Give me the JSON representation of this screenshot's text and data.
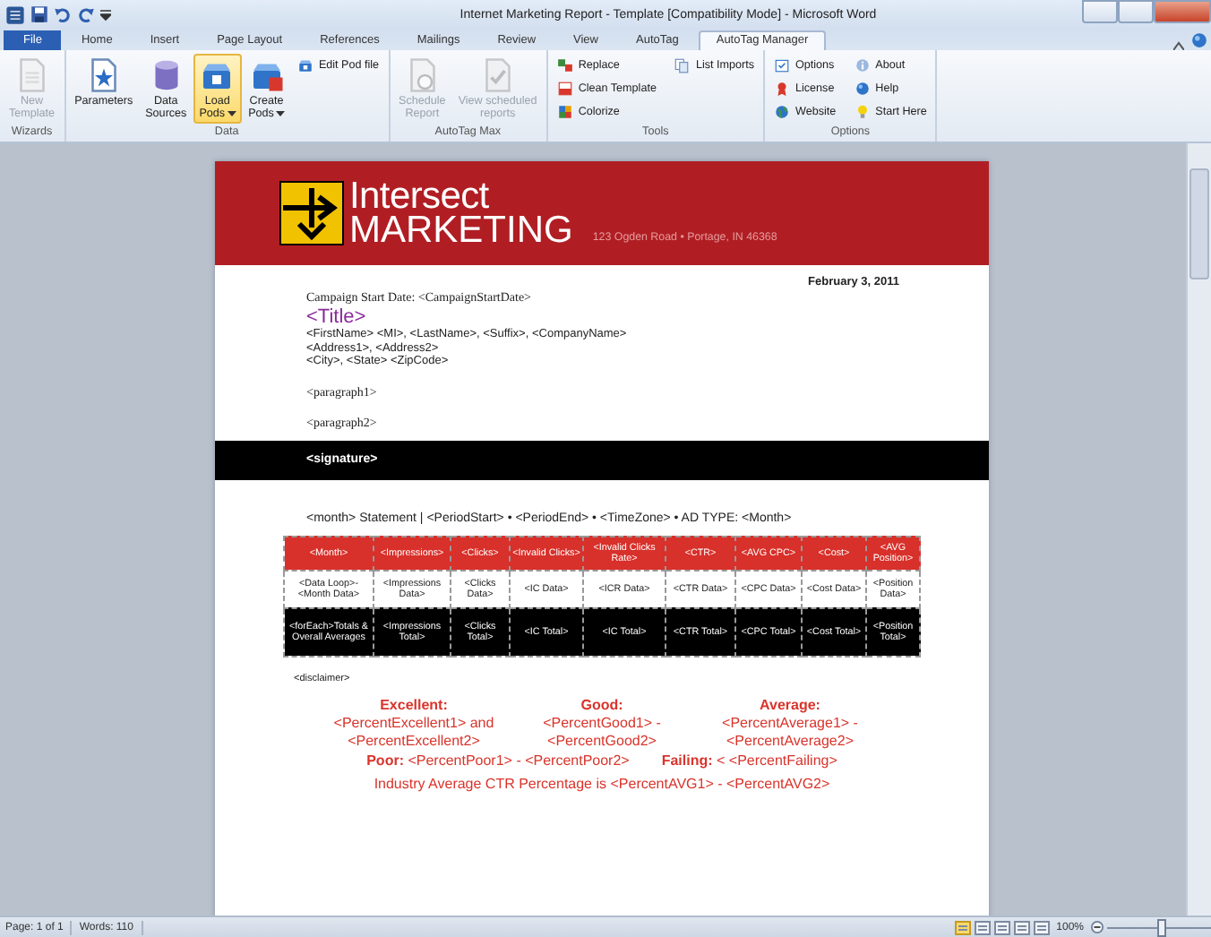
{
  "window": {
    "title": "Internet Marketing Report - Template [Compatibility Mode] - Microsoft Word"
  },
  "tabs": [
    {
      "label": "File",
      "kind": "file",
      "selected": false
    },
    {
      "label": "Home",
      "kind": "normal",
      "selected": false
    },
    {
      "label": "Insert",
      "kind": "normal",
      "selected": false
    },
    {
      "label": "Page Layout",
      "kind": "normal",
      "selected": false
    },
    {
      "label": "References",
      "kind": "normal",
      "selected": false
    },
    {
      "label": "Mailings",
      "kind": "normal",
      "selected": false
    },
    {
      "label": "Review",
      "kind": "normal",
      "selected": false
    },
    {
      "label": "View",
      "kind": "normal",
      "selected": false
    },
    {
      "label": "AutoTag",
      "kind": "normal",
      "selected": false
    },
    {
      "label": "AutoTag Manager",
      "kind": "normal",
      "selected": true
    }
  ],
  "ribbon": {
    "groups": [
      {
        "label": "Wizards",
        "large_buttons": [
          {
            "label_lines": [
              "New",
              "Template"
            ],
            "kind": "doc",
            "disabled": true,
            "highlighted": false,
            "dropdown": false
          }
        ]
      },
      {
        "label": "Data",
        "large_buttons": [
          {
            "label_lines": [
              "Parameters"
            ],
            "kind": "params",
            "disabled": false,
            "highlighted": false,
            "dropdown": false
          },
          {
            "label_lines": [
              "Data",
              "Sources"
            ],
            "kind": "db",
            "disabled": false,
            "highlighted": false,
            "dropdown": false
          },
          {
            "label_lines": [
              "Load",
              "Pods"
            ],
            "kind": "pods",
            "disabled": false,
            "highlighted": true,
            "dropdown": true
          },
          {
            "label_lines": [
              "Create",
              "Pods"
            ],
            "kind": "podscreate",
            "disabled": false,
            "highlighted": false,
            "dropdown": true
          }
        ],
        "small_buttons": [
          {
            "label": "Edit Pod file",
            "kind": "pods",
            "disabled": false
          }
        ]
      },
      {
        "label": "AutoTag Max",
        "large_buttons": [
          {
            "label_lines": [
              "Schedule",
              "Report"
            ],
            "kind": "schedule",
            "disabled": true,
            "highlighted": false,
            "dropdown": false
          },
          {
            "label_lines": [
              "View scheduled",
              "reports"
            ],
            "kind": "reports",
            "disabled": true,
            "highlighted": false,
            "dropdown": false
          }
        ]
      },
      {
        "label": "Tools",
        "small_buttons": [
          {
            "label": "Replace",
            "kind": "replace",
            "disabled": false
          },
          {
            "label": "Clean Template",
            "kind": "clean",
            "disabled": false
          },
          {
            "label": "Colorize",
            "kind": "colorize",
            "disabled": false
          },
          {
            "label": "List Imports",
            "kind": "list",
            "disabled": false
          }
        ]
      },
      {
        "label": "Options",
        "small_buttons": [
          {
            "label": "Options",
            "kind": "options",
            "disabled": false
          },
          {
            "label": "License",
            "kind": "license",
            "disabled": false
          },
          {
            "label": "Website",
            "kind": "website",
            "disabled": false
          },
          {
            "label": "About",
            "kind": "about",
            "disabled": false
          },
          {
            "label": "Help",
            "kind": "help",
            "disabled": false
          },
          {
            "label": "Start Here",
            "kind": "start",
            "disabled": false
          }
        ]
      }
    ]
  },
  "document": {
    "header": {
      "brand_top": "Intersect",
      "brand_bottom": "MARKETING",
      "address": "123 Ogden Road • Portage, IN 46368"
    },
    "date": "February 3, 2011",
    "campaign_line": "Campaign Start Date:  <CampaignStartDate>",
    "title": "<Title>",
    "address_lines": [
      "<FirstName>  <MI>, <LastName>,  <Suffix>, <CompanyName>",
      "<Address1>,  <Address2>",
      "<City>,  <State>  <ZipCode>"
    ],
    "paragraphs": [
      "<paragraph1>",
      "<paragraph2>"
    ],
    "signature": "<signature>",
    "statement": "<month> Statement |  <PeriodStart> •  <PeriodEnd> •  <TimeZone> • AD TYPE:  <Month>",
    "table": {
      "columns": [
        "<Month>",
        "<Impressions>",
        "<Clicks>",
        "<Invalid Clicks>",
        "<Invalid Clicks Rate>",
        "<CTR>",
        "<AVG CPC>",
        "<Cost>",
        "<AVG Position>"
      ],
      "rows": [
        {
          "kind": "data",
          "cells": [
            "<Data Loop>-<Month Data>",
            "<Impressions Data>",
            "<Clicks Data>",
            "<IC Data>",
            "<ICR Data>",
            "<CTR Data>",
            "<CPC Data>",
            "<Cost Data>",
            "<Position Data>"
          ]
        },
        {
          "kind": "total",
          "cells": [
            "<forEach>Totals & Overall Averages",
            "<Impressions Total>",
            "<Clicks Total>",
            "<IC Total>",
            "<IC Total>",
            "<CTR Total>",
            "<CPC Total>",
            "<Cost Total>",
            "<Position Total>"
          ]
        }
      ]
    },
    "disclaimer": "<disclaimer>",
    "ratings": [
      {
        "label": "Excellent:",
        "range": "<PercentExcellent1> and <PercentExcellent2>"
      },
      {
        "label": "Good:",
        "range": "<PercentGood1> - <PercentGood2>"
      },
      {
        "label": "Average:",
        "range": "<PercentAverage1> - <PercentAverage2>"
      }
    ],
    "thresholds": [
      "**Poor:** <PercentPoor1> - <PercentPoor2>",
      "**Failing:** < <PercentFailing>"
    ],
    "industry": "Industry Average CTR Percentage is <PercentAVG1> - <PercentAVG2>"
  },
  "status_bar": {
    "page": "Page: 1 of 1",
    "words": "Words: 110",
    "zoom": {
      "label": "100%",
      "level": 0.5
    }
  }
}
